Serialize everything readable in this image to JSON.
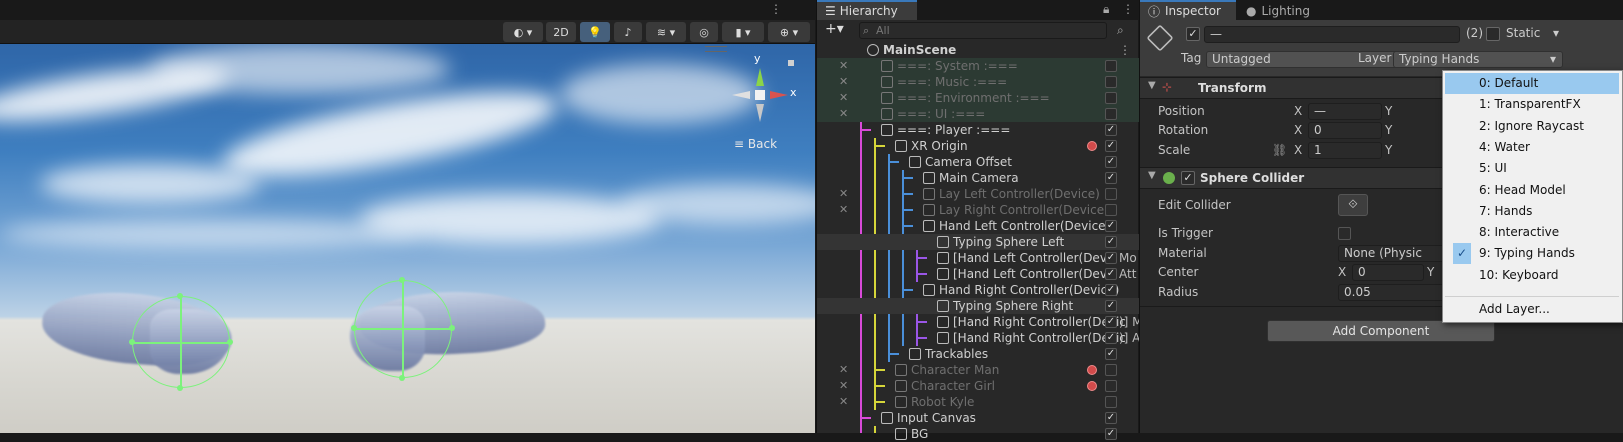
{
  "scene": {
    "toolbar": {
      "mode_2d": "2D"
    },
    "gizmo": {
      "y": "y",
      "x": "x"
    },
    "back_label": "Back"
  },
  "hierarchy": {
    "tab": "Hierarchy",
    "search_placeholder": "All",
    "items": [
      {
        "label": "MainScene",
        "depth": 0,
        "bold": true,
        "checked": null,
        "dim": false,
        "badge": false
      },
      {
        "label": "===: System :===",
        "depth": 1,
        "checked": false,
        "dim": true,
        "badge": false
      },
      {
        "label": "===: Music :===",
        "depth": 1,
        "checked": false,
        "dim": true,
        "badge": false
      },
      {
        "label": "===: Environment :===",
        "depth": 1,
        "checked": false,
        "dim": true,
        "badge": false
      },
      {
        "label": "===: UI :===",
        "depth": 1,
        "checked": false,
        "dim": true,
        "badge": false
      },
      {
        "label": "===: Player :===",
        "depth": 1,
        "checked": true,
        "dim": false,
        "badge": false
      },
      {
        "label": "XR Origin",
        "depth": 2,
        "checked": true,
        "dim": false,
        "badge": true
      },
      {
        "label": "Camera Offset",
        "depth": 3,
        "checked": true,
        "dim": false,
        "badge": false
      },
      {
        "label": "Main Camera",
        "depth": 4,
        "checked": true,
        "dim": false,
        "badge": false
      },
      {
        "label": "Lay Left Controller(Device)",
        "depth": 4,
        "checked": false,
        "dim": true,
        "badge": false
      },
      {
        "label": "Lay Right Controller(Device)",
        "depth": 4,
        "checked": false,
        "dim": true,
        "badge": false
      },
      {
        "label": "Hand Left Controller(Device)",
        "depth": 4,
        "checked": true,
        "dim": false,
        "badge": false
      },
      {
        "label": "Typing Sphere Left",
        "depth": 5,
        "checked": true,
        "dim": false,
        "badge": false,
        "highlight": true
      },
      {
        "label": "[Hand Left Controller(Devic",
        "depth": 5,
        "checked": true,
        "dim": false,
        "badge": false,
        "suffix": "Mo"
      },
      {
        "label": "[Hand Left Controller(Devic",
        "depth": 5,
        "checked": true,
        "dim": false,
        "badge": false,
        "suffix": "Att"
      },
      {
        "label": "Hand Right Controller(Device)",
        "depth": 4,
        "checked": true,
        "dim": false,
        "badge": false
      },
      {
        "label": "Typing Sphere Right",
        "depth": 5,
        "checked": true,
        "dim": false,
        "badge": false,
        "highlight": true
      },
      {
        "label": "[Hand Right Controller(Devic",
        "depth": 5,
        "checked": true,
        "dim": false,
        "badge": false,
        "suffix": ")] M"
      },
      {
        "label": "[Hand Right Controller(Devic",
        "depth": 5,
        "checked": true,
        "dim": false,
        "badge": false,
        "suffix": ")] A"
      },
      {
        "label": "Trackables",
        "depth": 3,
        "checked": true,
        "dim": false,
        "badge": false
      },
      {
        "label": "Character Man",
        "depth": 2,
        "checked": false,
        "dim": true,
        "badge": true
      },
      {
        "label": "Character Girl",
        "depth": 2,
        "checked": false,
        "dim": true,
        "badge": true
      },
      {
        "label": "Robot Kyle",
        "depth": 2,
        "checked": false,
        "dim": true,
        "badge": false
      },
      {
        "label": "Input Canvas",
        "depth": 1,
        "checked": true,
        "dim": false,
        "badge": false
      },
      {
        "label": "BG",
        "depth": 2,
        "checked": true,
        "dim": false,
        "badge": false
      }
    ]
  },
  "inspector": {
    "tabs": [
      "Inspector",
      "Lighting"
    ],
    "object_name": "—",
    "count_label": "(2)",
    "static_label": "Static",
    "tag_label": "Tag",
    "tag_value": "Untagged",
    "layer_label": "Layer",
    "layer_value": "Typing Hands",
    "transform": {
      "title": "Transform",
      "position_label": "Position",
      "rotation_label": "Rotation",
      "scale_label": "Scale",
      "x_label": "X",
      "y_label": "Y",
      "position_x": "—",
      "rotation_x": "0",
      "scale_x": "1"
    },
    "collider": {
      "title": "Sphere Collider",
      "edit_label": "Edit Collider",
      "trigger_label": "Is Trigger",
      "material_label": "Material",
      "material_value": "None (Physic Mat",
      "center_label": "Center",
      "center_x": "0",
      "radius_label": "Radius",
      "radius_value": "0.05"
    },
    "add_component": "Add Component"
  },
  "layer_dropdown": {
    "items": [
      "0: Default",
      "1: TransparentFX",
      "2: Ignore Raycast",
      "4: Water",
      "5: UI",
      "6: Head Model",
      "7: Hands",
      "8: Interactive",
      "9: Typing Hands",
      "10: Keyboard"
    ],
    "highlighted": "0: Default",
    "checked": "9: Typing Hands",
    "add_layer": "Add Layer..."
  },
  "colors": {
    "accent": "#3a79bb",
    "collider": "#7cf27c",
    "hier_pink": "#d94ad9",
    "hier_yellow": "#d6d63a",
    "hier_blue": "#4a8fd9",
    "hier_purple": "#9a56e6"
  }
}
